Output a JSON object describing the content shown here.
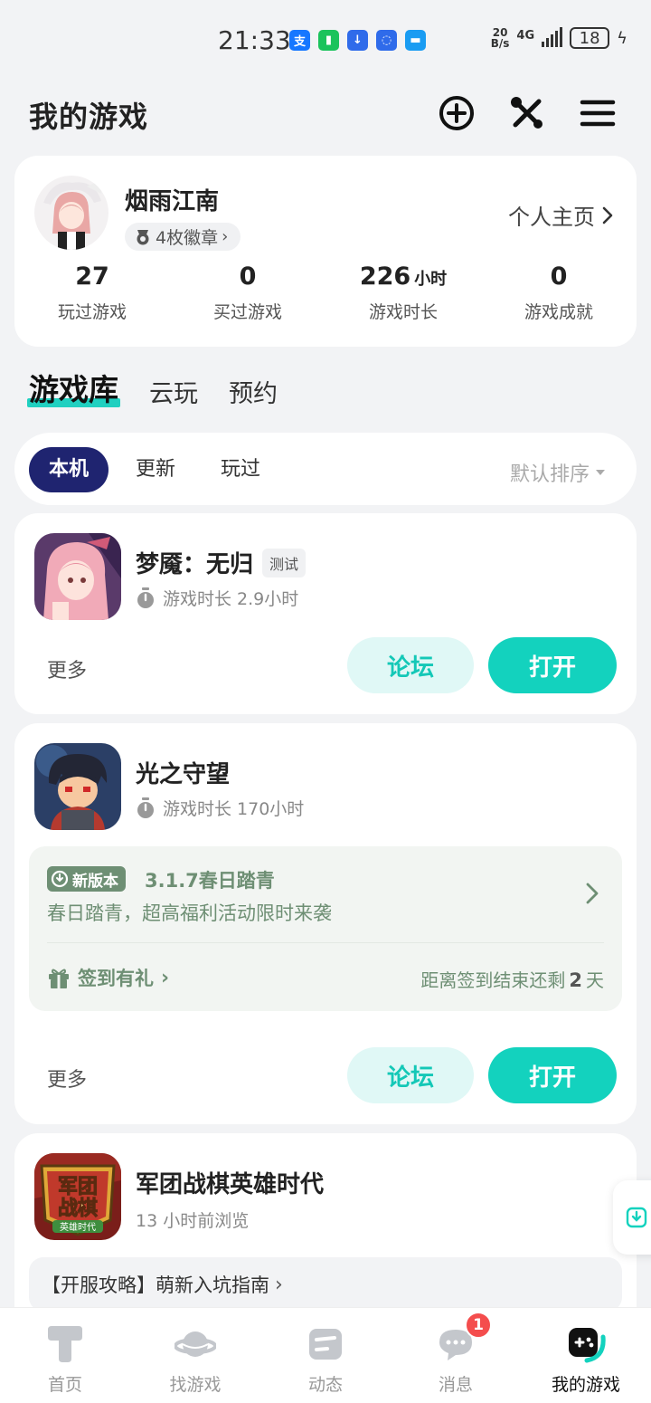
{
  "status_bar": {
    "time": "21:33",
    "app_icons": [
      {
        "icon": "alipay-icon",
        "glyph": "支",
        "color": "#1677ff"
      },
      {
        "icon": "green-app-icon",
        "glyph": "▮",
        "color": "#1bc35c"
      },
      {
        "icon": "download-app-icon",
        "glyph": "↓",
        "color": "#2f6bea"
      },
      {
        "icon": "bulb-app-icon",
        "glyph": "◌",
        "color": "#2f6bea"
      },
      {
        "icon": "chat-app-icon",
        "glyph": "▬",
        "color": "#1a9cf2"
      }
    ],
    "net_speed": "20",
    "net_unit": "B/s",
    "network": "4G",
    "battery": "18"
  },
  "header": {
    "title": "我的游戏"
  },
  "profile": {
    "username": "烟雨江南",
    "badges": "4枚徽章",
    "homepage_link": "个人主页",
    "stats": [
      {
        "value": "27",
        "unit": "",
        "label": "玩过游戏"
      },
      {
        "value": "0",
        "unit": "",
        "label": "买过游戏"
      },
      {
        "value": "226",
        "unit": "小时",
        "label": "游戏时长"
      },
      {
        "value": "0",
        "unit": "",
        "label": "游戏成就"
      }
    ]
  },
  "main_tabs": [
    "游戏库",
    "云玩",
    "预约"
  ],
  "filter": {
    "tabs": [
      "本机",
      "更新",
      "玩过"
    ],
    "sort": "默认排序"
  },
  "games": [
    {
      "name": "梦魇：无归",
      "tag": "测试",
      "playtime": "游戏时长 2.9小时",
      "more": "更多",
      "forum": "论坛",
      "open": "打开"
    },
    {
      "name": "光之守望",
      "playtime": "游戏时长 170小时",
      "update": {
        "tag": "新版本",
        "title": "3.1.7春日踏青",
        "desc": "春日踏青，超高福利活动限时来袭",
        "checkin": "签到有礼",
        "countdown_prefix": "距离签到结束还剩",
        "countdown_days": "2",
        "countdown_suffix": "天"
      },
      "more": "更多",
      "forum": "论坛",
      "open": "打开"
    },
    {
      "name": "军团战棋英雄时代",
      "browse": "13 小时前浏览",
      "icon_text_top": "军团",
      "icon_text_mid": "战棋",
      "icon_text_bottom": "英雄时代",
      "guide": "【开服攻略】萌新入坑指南"
    }
  ],
  "bottom_nav": [
    {
      "label": "首页",
      "icon": "home-icon"
    },
    {
      "label": "找游戏",
      "icon": "planet-icon"
    },
    {
      "label": "动态",
      "icon": "feed-icon"
    },
    {
      "label": "消息",
      "icon": "message-icon",
      "badge": "1"
    },
    {
      "label": "我的游戏",
      "icon": "gamepad-icon",
      "active": true
    }
  ],
  "colors": {
    "accent": "#13d2be",
    "accent_light": "#e0f8f6",
    "active_tab": "#1f2470",
    "update_green": "#6e8f74",
    "badge_red": "#f44d4d"
  }
}
